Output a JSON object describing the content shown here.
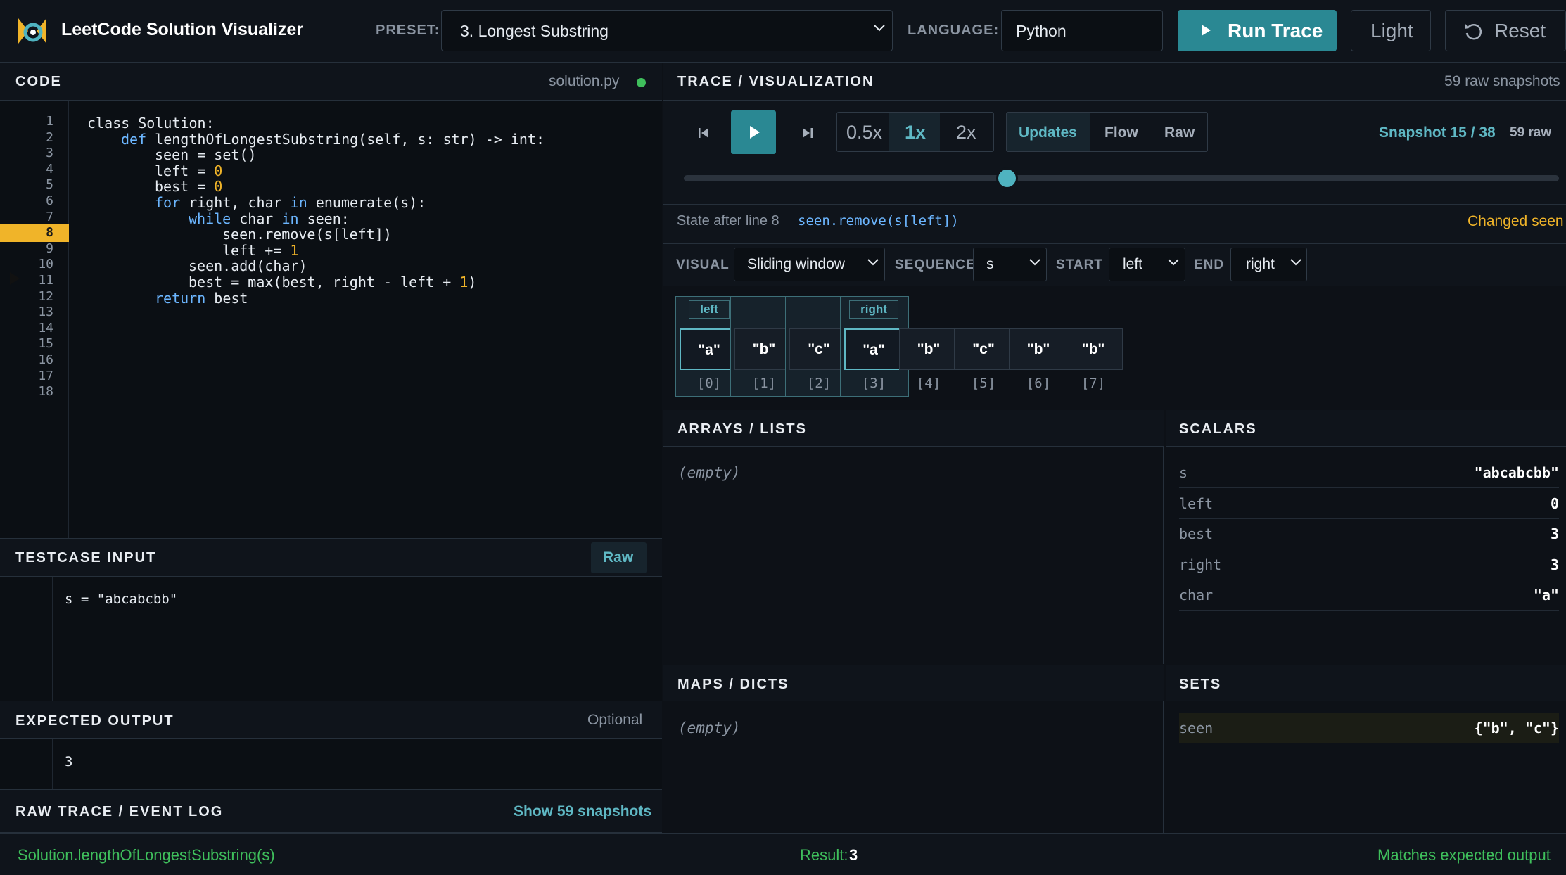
{
  "header": {
    "app_title": "LeetCode Solution Visualizer",
    "preset_label": "PRESET:",
    "preset_value": "3. Longest Substring",
    "language_label": "LANGUAGE:",
    "language_value": "Python",
    "run_label": "Run Trace",
    "light_label": "Light",
    "reset_label": "Reset"
  },
  "code_panel": {
    "title": "CODE",
    "file_name": "solution.py",
    "status_color": "#3fbf5c",
    "active_line": 8,
    "line_numbers": [
      "1",
      "2",
      "3",
      "4",
      "5",
      "6",
      "7",
      "8",
      "9",
      "10",
      "11",
      "12",
      "13",
      "14",
      "15",
      "16",
      "17",
      "18"
    ],
    "lines": [
      {
        "pre": "class Solution:"
      },
      {
        "kw": "def",
        "rest": " lengthOfLongestSubstring(self, s: str) -> int:"
      },
      {
        "pre": "seen = set()"
      },
      {
        "pre": "left = ",
        "num": "0"
      },
      {
        "pre": "best = ",
        "num": "0"
      },
      {
        "kw": "for",
        "mid": " right, char ",
        "kw2": "in",
        "rest": " enumerate(s):"
      },
      {
        "kw": "while",
        "mid": " char ",
        "kw2": "in",
        "rest": " seen:"
      },
      {
        "pre": "seen.remove(s[left])"
      },
      {
        "pre": "left += ",
        "num": "1"
      },
      {
        "pre": "seen.add(char)"
      },
      {
        "pre": "best = max(best, right - left + ",
        "num": "1",
        "post": ")"
      },
      {
        "kw": "return",
        "rest": " best"
      }
    ]
  },
  "testcase": {
    "title": "TESTCASE INPUT",
    "raw_label": "Raw",
    "text": "s = \"abcabcbb\""
  },
  "expected": {
    "title": "EXPECTED OUTPUT",
    "hint": "Optional",
    "text": "3"
  },
  "raw_trace": {
    "title": "RAW TRACE / EVENT LOG",
    "show_label": "Show 59 snapshots"
  },
  "trace": {
    "title": "TRACE / VISUALIZATION",
    "raw_count": "59 raw snapshots",
    "speeds": [
      "0.5x",
      "1x",
      "2x"
    ],
    "selected_speed": "1x",
    "modes": [
      "Updates",
      "Flow",
      "Raw"
    ],
    "selected_mode": "Updates",
    "snapshot_label": "Snapshot 15 / 38",
    "snapshot_raw": "59 raw",
    "slider_position": 0.37,
    "state_label": "State after line 8",
    "state_code": "seen.remove(s[left])",
    "changed_label": "Changed seen"
  },
  "visual": {
    "visual_cap": "VISUAL",
    "visual_value": "Sliding window",
    "sequence_cap": "SEQUENCE",
    "sequence_value": "s",
    "start_cap": "START",
    "start_value": "left",
    "end_cap": "END",
    "end_value": "right",
    "cells": [
      {
        "value": "\"a\"",
        "index": "[0]",
        "pointer": "left"
      },
      {
        "value": "\"b\"",
        "index": "[1]",
        "pointer": ""
      },
      {
        "value": "\"c\"",
        "index": "[2]",
        "pointer": ""
      },
      {
        "value": "\"a\"",
        "index": "[3]",
        "pointer": "right"
      },
      {
        "value": "\"b\"",
        "index": "[4]",
        "pointer": ""
      },
      {
        "value": "\"c\"",
        "index": "[5]",
        "pointer": ""
      },
      {
        "value": "\"b\"",
        "index": "[6]",
        "pointer": ""
      },
      {
        "value": "\"b\"",
        "index": "[7]",
        "pointer": ""
      }
    ],
    "window_start": 0,
    "window_end": 3
  },
  "arrays": {
    "title": "ARRAYS / LISTS",
    "empty": "(empty)"
  },
  "scalars": {
    "title": "SCALARS",
    "rows": [
      {
        "name": "s",
        "value": "\"abcabcbb\""
      },
      {
        "name": "left",
        "value": "0"
      },
      {
        "name": "best",
        "value": "3"
      },
      {
        "name": "right",
        "value": "3"
      },
      {
        "name": "char",
        "value": "\"a\""
      }
    ]
  },
  "maps": {
    "title": "MAPS / DICTS",
    "empty": "(empty)"
  },
  "sets": {
    "title": "SETS",
    "rows": [
      {
        "name": "seen",
        "value": "{\"b\", \"c\"}"
      }
    ]
  },
  "footer": {
    "call": "Solution.lengthOfLongestSubstring(s)",
    "result_label": "Result:",
    "result_value": "3",
    "status": "Matches expected output"
  }
}
